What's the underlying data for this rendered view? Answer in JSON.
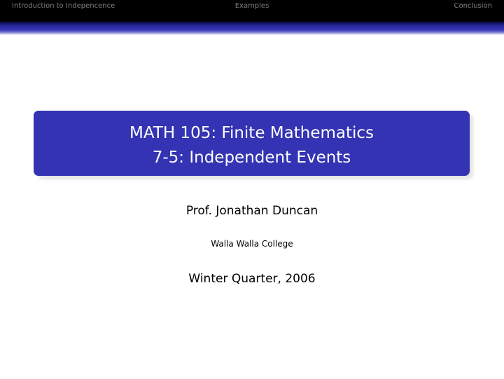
{
  "nav": {
    "sections": [
      "Introduction to Indepencence",
      "Examples",
      "Conclusion"
    ]
  },
  "title": {
    "line1": "MATH 105: Finite Mathematics",
    "line2": "7-5: Independent Events"
  },
  "author": "Prof. Jonathan Duncan",
  "institute": "Walla Walla College",
  "date": "Winter Quarter, 2006",
  "colors": {
    "header_background": "#000000",
    "nav_text": "#7f7f7f",
    "title_box": "#3333b3",
    "title_text": "#ffffff",
    "body_text": "#000000"
  }
}
